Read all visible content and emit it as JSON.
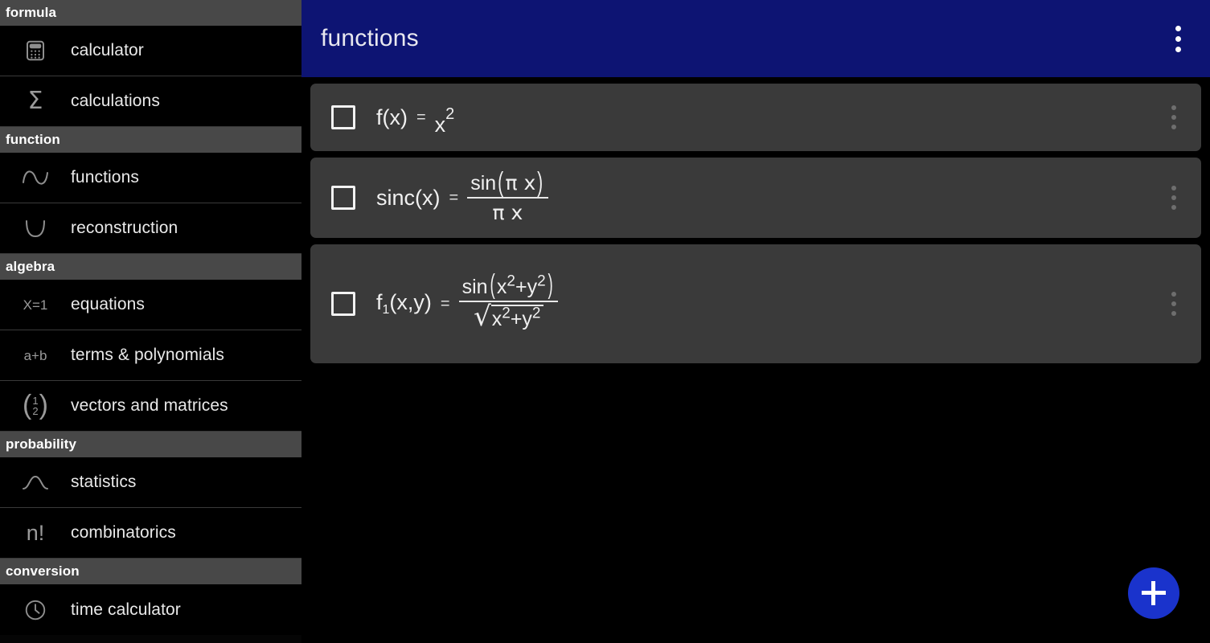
{
  "sidebar": {
    "sections": [
      {
        "title": "formula",
        "items": [
          {
            "label": "calculator",
            "icon": "calculator-icon"
          },
          {
            "label": "calculations",
            "icon": "sigma-icon"
          }
        ]
      },
      {
        "title": "function",
        "items": [
          {
            "label": "functions",
            "icon": "wave-curve-icon"
          },
          {
            "label": "reconstruction",
            "icon": "v-curve-icon"
          }
        ]
      },
      {
        "title": "algebra",
        "items": [
          {
            "label": "equations",
            "icon": "x-equals-one-icon",
            "icon_text": "X=1"
          },
          {
            "label": "terms & polynomials",
            "icon": "a-plus-b-icon",
            "icon_text": "a+b"
          },
          {
            "label": "vectors and matrices",
            "icon": "column-vector-icon",
            "icon_text": "(1/2)"
          }
        ]
      },
      {
        "title": "probability",
        "items": [
          {
            "label": "statistics",
            "icon": "bell-curve-icon"
          },
          {
            "label": "combinatorics",
            "icon": "n-factorial-icon",
            "icon_text": "n!"
          }
        ]
      },
      {
        "title": "conversion",
        "items": [
          {
            "label": "time calculator",
            "icon": "clock-icon"
          }
        ]
      }
    ]
  },
  "appbar": {
    "title": "functions",
    "overflow_icon": "more-vertical-icon"
  },
  "formulas": [
    {
      "id": "f-x-squared",
      "checked": false,
      "lhs": "f(x)",
      "equals": "=",
      "rhs_text": "x^2",
      "base": "x",
      "exponent": "2"
    },
    {
      "id": "sinc-x",
      "checked": false,
      "lhs": "sinc(x)",
      "equals": "=",
      "rhs_text": "sin(π x) / (π x)",
      "numerator": "sin(π x)",
      "denominator": "π x",
      "num_fn": "sin",
      "num_arg": "π x",
      "den": "π x"
    },
    {
      "id": "f1-x-y",
      "checked": false,
      "lhs": "f",
      "lhs_sub": "1",
      "lhs_args": "(x,y)",
      "equals": "=",
      "rhs_text": "sin(x^2+y^2) / sqrt(x^2+y^2)",
      "num_fn": "sin",
      "num_base1": "x",
      "num_exp1": "2",
      "num_op": "+",
      "num_base2": "y",
      "num_exp2": "2",
      "den_base1": "x",
      "den_exp1": "2",
      "den_op": "+",
      "den_base2": "y",
      "den_exp2": "2"
    }
  ],
  "fab": {
    "icon": "plus-icon",
    "label": "+"
  },
  "colors": {
    "appbar": "#0d1473",
    "fab": "#1a33cc",
    "card": "#3a3a3a",
    "section_header": "#484848",
    "background": "#000000"
  }
}
